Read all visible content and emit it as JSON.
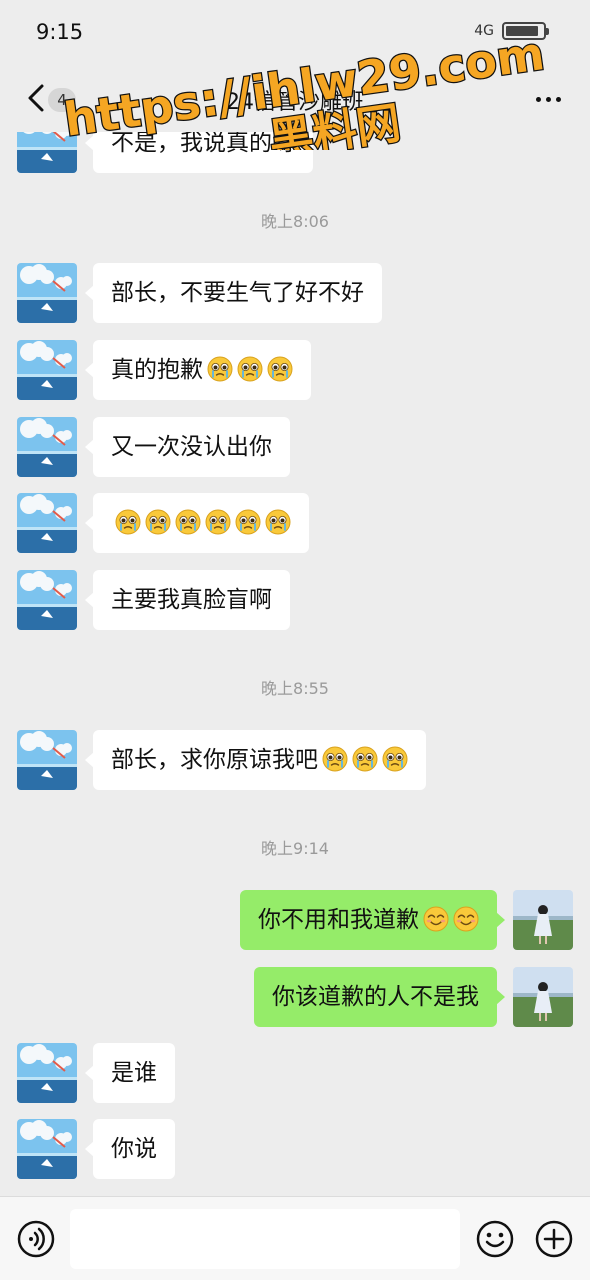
{
  "status_bar": {
    "time": "9:15",
    "network": "4G",
    "battery_level": 0.9
  },
  "header": {
    "title": "24信管沙雕班",
    "unread_count": "4"
  },
  "watermark": {
    "line1": "https://ihlw29.com",
    "line2": "黑料网"
  },
  "messages": [
    {
      "type": "text",
      "side": "left",
      "text": "不是，我说真的呀",
      "emoji_count": 0
    },
    {
      "type": "time",
      "text": "晚上8:06"
    },
    {
      "type": "text",
      "side": "left",
      "text": "部长，不要生气了好不好",
      "emoji_count": 0
    },
    {
      "type": "text",
      "side": "left",
      "text": "真的抱歉",
      "emoji_count": 3,
      "emoji": "pleading-face-icon"
    },
    {
      "type": "text",
      "side": "left",
      "text": "又一次没认出你",
      "emoji_count": 0
    },
    {
      "type": "text",
      "side": "left",
      "text": "",
      "emoji_count": 6,
      "emoji": "pleading-face-icon"
    },
    {
      "type": "text",
      "side": "left",
      "text": "主要我真脸盲啊",
      "emoji_count": 0
    },
    {
      "type": "time",
      "text": "晚上8:55"
    },
    {
      "type": "text",
      "side": "left",
      "text": "部长，求你原谅我吧",
      "emoji_count": 3,
      "emoji": "pleading-face-icon"
    },
    {
      "type": "time",
      "text": "晚上9:14"
    },
    {
      "type": "text",
      "side": "right",
      "text": "你不用和我道歉",
      "emoji_count": 2,
      "emoji": "smiling-face-icon"
    },
    {
      "type": "text",
      "side": "right",
      "text": "你该道歉的人不是我",
      "emoji_count": 0
    },
    {
      "type": "text",
      "side": "left",
      "text": "是谁",
      "emoji_count": 0
    },
    {
      "type": "text",
      "side": "left",
      "text": "你说",
      "emoji_count": 0
    }
  ],
  "input": {
    "placeholder": ""
  },
  "colors": {
    "background": "#ededed",
    "bubble_self": "#95ec69",
    "bubble_other": "#ffffff",
    "watermark_fill": "#f5a623",
    "watermark_stroke": "#111111"
  }
}
